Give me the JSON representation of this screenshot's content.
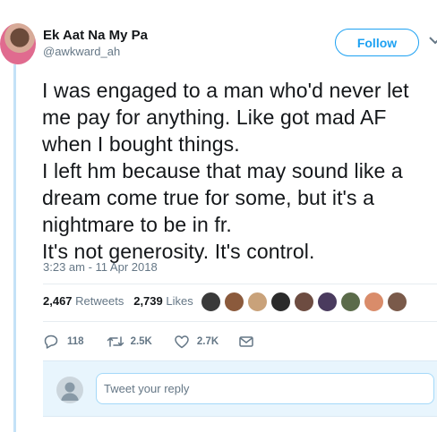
{
  "author": {
    "name": "Ek Aat Na My Pa",
    "handle": "@awkward_ah"
  },
  "follow_label": "Follow",
  "tweet": {
    "lines": [
      "I was engaged to a man who'd never let",
      "me pay for anything. Like got mad AF",
      "when I bought things.",
      "I left hm because that may sound like a",
      "dream come true for some, but it's a",
      "nightmare to be in fr.",
      "It's not generosity. It's control."
    ],
    "timestamp": "3:23 am - 11 Apr 2018"
  },
  "stats": {
    "retweets_count": "2,467",
    "retweets_label": "Retweets",
    "likes_count": "2,739",
    "likes_label": "Likes"
  },
  "liker_avatars": [
    {
      "name": "liker-avatar-1",
      "color": "#3a3a3a"
    },
    {
      "name": "liker-avatar-2",
      "color": "#8b5a3c"
    },
    {
      "name": "liker-avatar-3",
      "color": "#c9a27a"
    },
    {
      "name": "liker-avatar-4",
      "color": "#2b2b2b"
    },
    {
      "name": "liker-avatar-5",
      "color": "#6d4c41"
    },
    {
      "name": "liker-avatar-6",
      "color": "#4a3b5e"
    },
    {
      "name": "liker-avatar-7",
      "color": "#5b6b4a"
    },
    {
      "name": "liker-avatar-8",
      "color": "#d98c6a"
    },
    {
      "name": "liker-avatar-9",
      "color": "#7a5a4a"
    }
  ],
  "actions": {
    "reply_count": "118",
    "retweet_count": "2.5K",
    "like_count": "2.7K"
  },
  "reply_box": {
    "placeholder": "Tweet your reply"
  },
  "colors": {
    "accent": "#1da1f2",
    "muted": "#657786",
    "reply_bg": "#e8f5fd"
  }
}
